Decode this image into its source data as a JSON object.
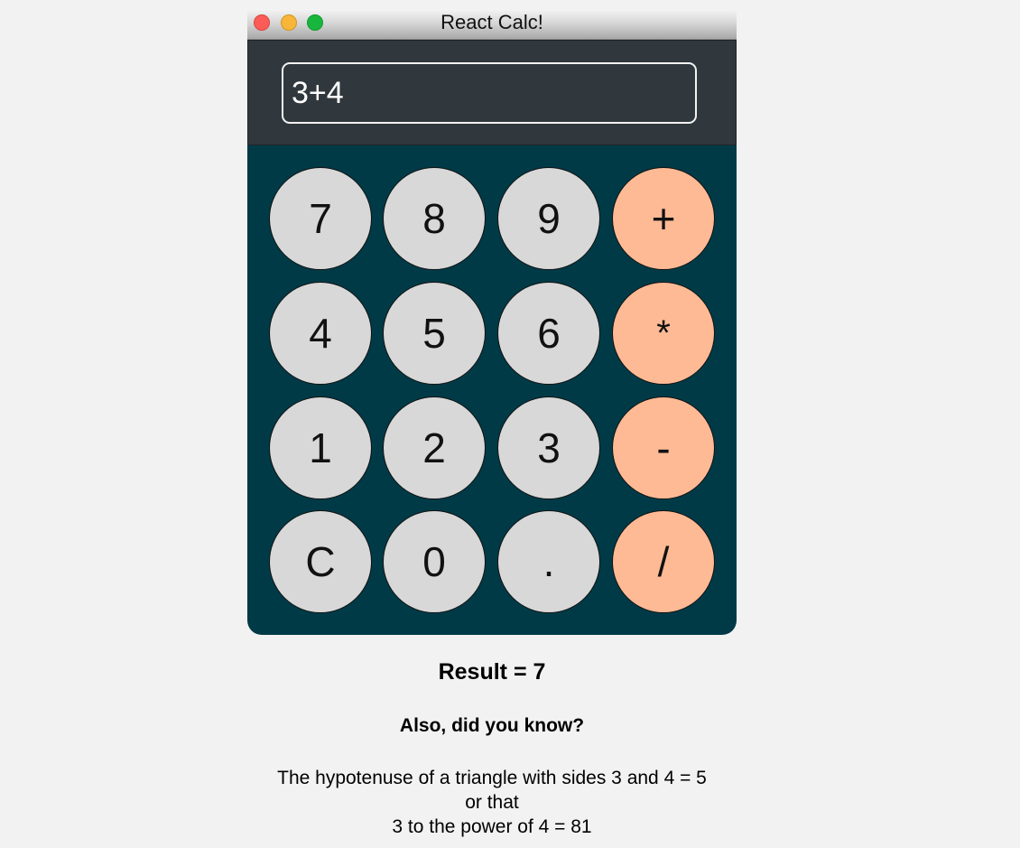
{
  "window": {
    "title": "React Calc!"
  },
  "display": {
    "value": "3+4"
  },
  "keypad": {
    "rows": [
      [
        "7",
        "8",
        "9",
        "+"
      ],
      [
        "4",
        "5",
        "6",
        "*"
      ],
      [
        "1",
        "2",
        "3",
        "-"
      ],
      [
        "C",
        "0",
        ".",
        "/"
      ]
    ]
  },
  "colors": {
    "keypad_background": "#003a47",
    "display_background": "#30383d",
    "digit_key": "#d8d8d8",
    "operator_key": "#fdba95"
  },
  "output": {
    "result": "Result = 7",
    "did_you_know": "Also, did you know?",
    "fact_line1": "The hypotenuse of a triangle with sides 3 and 4 = 5",
    "fact_line2": "or that",
    "fact_line3": "3 to the power of 4 = 81"
  }
}
